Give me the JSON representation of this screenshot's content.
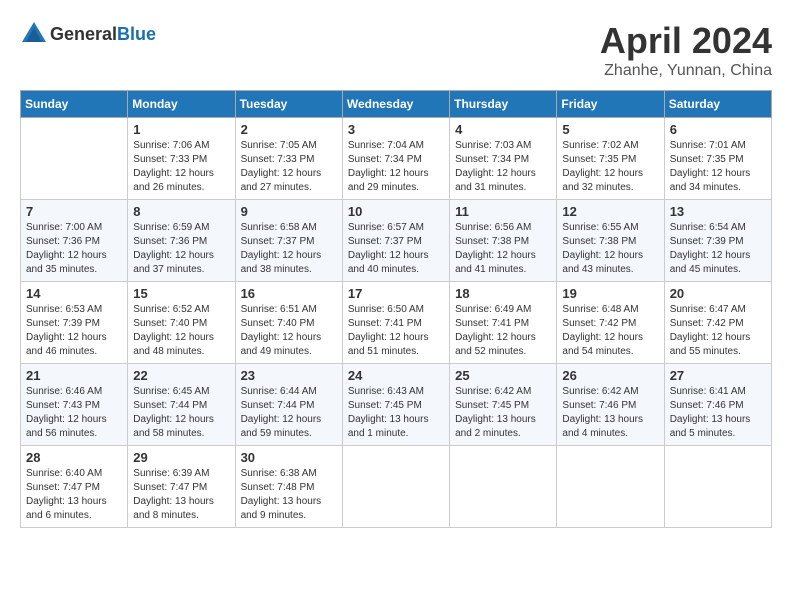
{
  "header": {
    "logo_general": "General",
    "logo_blue": "Blue",
    "month_year": "April 2024",
    "location": "Zhanhe, Yunnan, China"
  },
  "days_of_week": [
    "Sunday",
    "Monday",
    "Tuesday",
    "Wednesday",
    "Thursday",
    "Friday",
    "Saturday"
  ],
  "weeks": [
    [
      {
        "day": "",
        "info": ""
      },
      {
        "day": "1",
        "info": "Sunrise: 7:06 AM\nSunset: 7:33 PM\nDaylight: 12 hours\nand 26 minutes."
      },
      {
        "day": "2",
        "info": "Sunrise: 7:05 AM\nSunset: 7:33 PM\nDaylight: 12 hours\nand 27 minutes."
      },
      {
        "day": "3",
        "info": "Sunrise: 7:04 AM\nSunset: 7:34 PM\nDaylight: 12 hours\nand 29 minutes."
      },
      {
        "day": "4",
        "info": "Sunrise: 7:03 AM\nSunset: 7:34 PM\nDaylight: 12 hours\nand 31 minutes."
      },
      {
        "day": "5",
        "info": "Sunrise: 7:02 AM\nSunset: 7:35 PM\nDaylight: 12 hours\nand 32 minutes."
      },
      {
        "day": "6",
        "info": "Sunrise: 7:01 AM\nSunset: 7:35 PM\nDaylight: 12 hours\nand 34 minutes."
      }
    ],
    [
      {
        "day": "7",
        "info": "Sunrise: 7:00 AM\nSunset: 7:36 PM\nDaylight: 12 hours\nand 35 minutes."
      },
      {
        "day": "8",
        "info": "Sunrise: 6:59 AM\nSunset: 7:36 PM\nDaylight: 12 hours\nand 37 minutes."
      },
      {
        "day": "9",
        "info": "Sunrise: 6:58 AM\nSunset: 7:37 PM\nDaylight: 12 hours\nand 38 minutes."
      },
      {
        "day": "10",
        "info": "Sunrise: 6:57 AM\nSunset: 7:37 PM\nDaylight: 12 hours\nand 40 minutes."
      },
      {
        "day": "11",
        "info": "Sunrise: 6:56 AM\nSunset: 7:38 PM\nDaylight: 12 hours\nand 41 minutes."
      },
      {
        "day": "12",
        "info": "Sunrise: 6:55 AM\nSunset: 7:38 PM\nDaylight: 12 hours\nand 43 minutes."
      },
      {
        "day": "13",
        "info": "Sunrise: 6:54 AM\nSunset: 7:39 PM\nDaylight: 12 hours\nand 45 minutes."
      }
    ],
    [
      {
        "day": "14",
        "info": "Sunrise: 6:53 AM\nSunset: 7:39 PM\nDaylight: 12 hours\nand 46 minutes."
      },
      {
        "day": "15",
        "info": "Sunrise: 6:52 AM\nSunset: 7:40 PM\nDaylight: 12 hours\nand 48 minutes."
      },
      {
        "day": "16",
        "info": "Sunrise: 6:51 AM\nSunset: 7:40 PM\nDaylight: 12 hours\nand 49 minutes."
      },
      {
        "day": "17",
        "info": "Sunrise: 6:50 AM\nSunset: 7:41 PM\nDaylight: 12 hours\nand 51 minutes."
      },
      {
        "day": "18",
        "info": "Sunrise: 6:49 AM\nSunset: 7:41 PM\nDaylight: 12 hours\nand 52 minutes."
      },
      {
        "day": "19",
        "info": "Sunrise: 6:48 AM\nSunset: 7:42 PM\nDaylight: 12 hours\nand 54 minutes."
      },
      {
        "day": "20",
        "info": "Sunrise: 6:47 AM\nSunset: 7:42 PM\nDaylight: 12 hours\nand 55 minutes."
      }
    ],
    [
      {
        "day": "21",
        "info": "Sunrise: 6:46 AM\nSunset: 7:43 PM\nDaylight: 12 hours\nand 56 minutes."
      },
      {
        "day": "22",
        "info": "Sunrise: 6:45 AM\nSunset: 7:44 PM\nDaylight: 12 hours\nand 58 minutes."
      },
      {
        "day": "23",
        "info": "Sunrise: 6:44 AM\nSunset: 7:44 PM\nDaylight: 12 hours\nand 59 minutes."
      },
      {
        "day": "24",
        "info": "Sunrise: 6:43 AM\nSunset: 7:45 PM\nDaylight: 13 hours\nand 1 minute."
      },
      {
        "day": "25",
        "info": "Sunrise: 6:42 AM\nSunset: 7:45 PM\nDaylight: 13 hours\nand 2 minutes."
      },
      {
        "day": "26",
        "info": "Sunrise: 6:42 AM\nSunset: 7:46 PM\nDaylight: 13 hours\nand 4 minutes."
      },
      {
        "day": "27",
        "info": "Sunrise: 6:41 AM\nSunset: 7:46 PM\nDaylight: 13 hours\nand 5 minutes."
      }
    ],
    [
      {
        "day": "28",
        "info": "Sunrise: 6:40 AM\nSunset: 7:47 PM\nDaylight: 13 hours\nand 6 minutes."
      },
      {
        "day": "29",
        "info": "Sunrise: 6:39 AM\nSunset: 7:47 PM\nDaylight: 13 hours\nand 8 minutes."
      },
      {
        "day": "30",
        "info": "Sunrise: 6:38 AM\nSunset: 7:48 PM\nDaylight: 13 hours\nand 9 minutes."
      },
      {
        "day": "",
        "info": ""
      },
      {
        "day": "",
        "info": ""
      },
      {
        "day": "",
        "info": ""
      },
      {
        "day": "",
        "info": ""
      }
    ]
  ]
}
